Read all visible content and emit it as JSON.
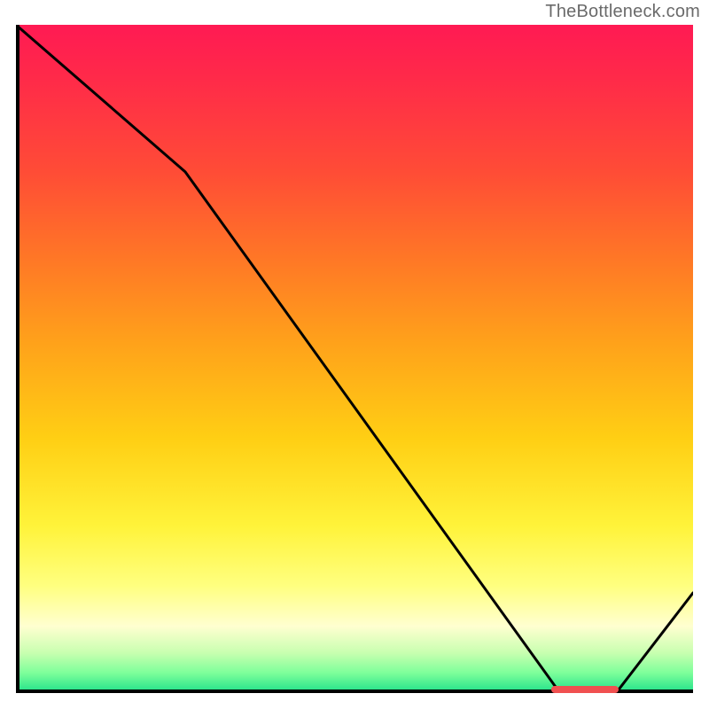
{
  "watermark": "TheBottleneck.com",
  "chart_data": {
    "type": "line",
    "title": "",
    "xlabel": "",
    "ylabel": "",
    "xlim": [
      0,
      100
    ],
    "ylim": [
      0,
      100
    ],
    "x": [
      0,
      25,
      80,
      89,
      100
    ],
    "values": [
      100,
      78,
      0.5,
      0.5,
      15
    ],
    "optimal_range": {
      "start": 79,
      "end": 89
    },
    "gradient_stops": [
      {
        "pct": 0,
        "color": "#ff1a53"
      },
      {
        "pct": 22,
        "color": "#ff4c36"
      },
      {
        "pct": 48,
        "color": "#ffa31a"
      },
      {
        "pct": 75,
        "color": "#fff33a"
      },
      {
        "pct": 90,
        "color": "#ffffd0"
      },
      {
        "pct": 100,
        "color": "#1ee08a"
      }
    ]
  },
  "colors": {
    "axis": "#000000",
    "curve": "#000000",
    "marker": "#f05050",
    "watermark": "#6a6a6a"
  }
}
